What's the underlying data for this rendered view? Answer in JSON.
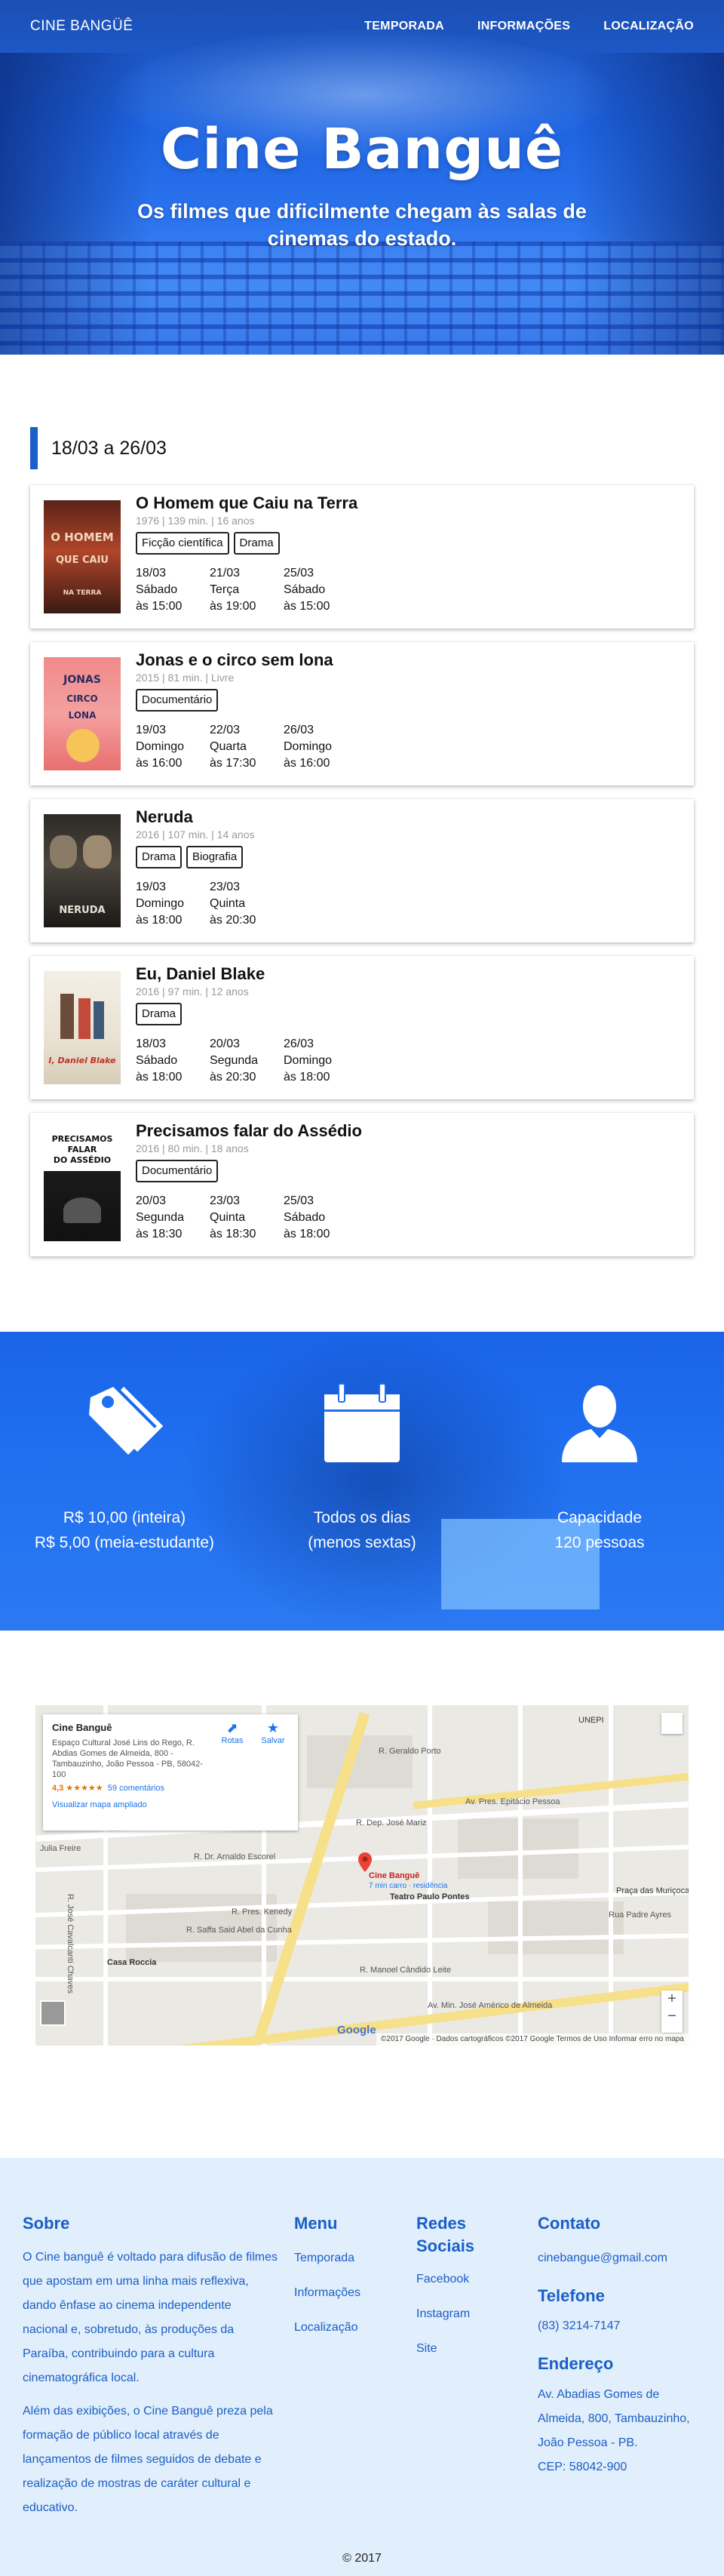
{
  "nav": {
    "brand": "CINE BANGÜÊ",
    "items": [
      "TEMPORADA",
      "INFORMAÇÕES",
      "LOCALIZAÇÃO"
    ]
  },
  "hero": {
    "title": "Cine Banguê",
    "subtitle": "Os filmes que dificilmente chegam às salas de cinemas do estado."
  },
  "schedule": {
    "week": "18/03 a 26/03",
    "movies": [
      {
        "title": "O Homem que Caiu na Terra",
        "meta": "1976 | 139 min. | 16 anos",
        "genres": [
          "Ficção científica",
          "Drama"
        ],
        "poster_text": [
          "O HOMEM",
          "QUE CAIU",
          "NA TERRA"
        ],
        "sessions": [
          {
            "date": "18/03",
            "day": "Sábado",
            "time": "às 15:00"
          },
          {
            "date": "21/03",
            "day": "Terça",
            "time": "às 19:00"
          },
          {
            "date": "25/03",
            "day": "Sábado",
            "time": "às 15:00"
          }
        ]
      },
      {
        "title": "Jonas e o circo sem lona",
        "meta": "2015 | 81 min. | Livre",
        "genres": [
          "Documentário"
        ],
        "poster_text": [
          "JONAS",
          "CIRCO",
          "LONA"
        ],
        "sessions": [
          {
            "date": "19/03",
            "day": "Domingo",
            "time": "às 16:00"
          },
          {
            "date": "22/03",
            "day": "Quarta",
            "time": "às 17:30"
          },
          {
            "date": "26/03",
            "day": "Domingo",
            "time": "às 16:00"
          }
        ]
      },
      {
        "title": "Neruda",
        "meta": "2016 | 107 min. | 14 anos",
        "genres": [
          "Drama",
          "Biografia"
        ],
        "poster_text": [
          "NERUDA"
        ],
        "sessions": [
          {
            "date": "19/03",
            "day": "Domingo",
            "time": "às 18:00"
          },
          {
            "date": "23/03",
            "day": "Quinta",
            "time": "às 20:30"
          }
        ]
      },
      {
        "title": "Eu, Daniel Blake",
        "meta": "2016 | 97 min. | 12 anos",
        "genres": [
          "Drama"
        ],
        "poster_text": [
          "I, Daniel Blake"
        ],
        "sessions": [
          {
            "date": "18/03",
            "day": "Sábado",
            "time": "às 18:00"
          },
          {
            "date": "20/03",
            "day": "Segunda",
            "time": "às 20:30"
          },
          {
            "date": "26/03",
            "day": "Domingo",
            "time": "às 18:00"
          }
        ]
      },
      {
        "title": "Precisamos falar do Assédio",
        "meta": "2016 | 80 min. | 18 anos",
        "genres": [
          "Documentário"
        ],
        "poster_text": [
          "PRECISAMOS",
          "FALAR",
          "DO ASSÉDIO"
        ],
        "sessions": [
          {
            "date": "20/03",
            "day": "Segunda",
            "time": "às 18:30"
          },
          {
            "date": "23/03",
            "day": "Quinta",
            "time": "às 18:30"
          },
          {
            "date": "25/03",
            "day": "Sábado",
            "time": "às 18:00"
          }
        ]
      }
    ]
  },
  "info": {
    "price": {
      "icon": "price-tag-icon",
      "lines": [
        "R$ 10,00 (inteira)",
        "R$ 5,00 (meia-estudante)"
      ]
    },
    "days": {
      "icon": "calendar-icon",
      "lines": [
        "Todos os dias",
        "(menos sextas)"
      ]
    },
    "capacity": {
      "icon": "person-icon",
      "lines": [
        "Capacidade",
        "120 pessoas"
      ]
    }
  },
  "map": {
    "place_name": "Cine Banguê",
    "address": "Espaço Cultural José Lins do Rego, R. Abdias Gomes de Almeida, 800 - Tambauzinho, João Pessoa - PB, 58042-100",
    "rating": "4,3 ★★★★★",
    "reviews": "59 comentários",
    "larger_map": "Visualizar mapa ampliado",
    "directions": "Rotas",
    "save": "Salvar",
    "pin_label": "Cine Banguê",
    "pin_sub": "7 min carro · residência",
    "labels": [
      "Teatro Paulo Pontes",
      "Casa Roccia",
      "Praça das Muriçocas",
      "UNEPI",
      "R. Dep. José Mariz",
      "R. Dr. Arnaldo Escorel",
      "R. Pres. Kenedy",
      "R. Saffa Said Abel da Cunha",
      "R. Manoel Cândido Leite",
      "Av. Min. José Américo de Almeida",
      "Av. Pres. Epitácio Pessoa",
      "R. Geraldo Porto",
      "Rua Padre Ayres",
      "Julia Freire",
      "R. José Cavalcanti Chaves"
    ],
    "attribution": "©2017 Google · Dados cartográficos ©2017 Google    Termos de Uso    Informar erro no mapa",
    "google": "Google"
  },
  "footer": {
    "about_title": "Sobre",
    "about_p1": "O Cine banguê é voltado para difusão de filmes que apostam em uma linha mais reflexiva, dando ênfase ao cinema independente nacional e, sobretudo, às produções da Paraíba, contribuindo para a cultura cinematográfica local.",
    "about_p2": "Além das exibições, o Cine Banguê preza pela formação de público local através de lançamentos de filmes seguidos de debate e realização de mostras de caráter cultural e educativo.",
    "menu_title": "Menu",
    "menu_items": [
      "Temporada",
      "Informações",
      "Localização"
    ],
    "social_title": "Redes Sociais",
    "social_items": [
      "Facebook",
      "Instagram",
      "Site"
    ],
    "contact_title": "Contato",
    "email": "cinebangue@gmail.com",
    "phone_title": "Telefone",
    "phone": "(83) 3214-7147",
    "address_title": "Endereço",
    "address": "Av. Abadias Gomes de Almeida, 800, Tambauzinho, João Pessoa - PB.",
    "cep": "CEP: 58042-900",
    "copyright": "© 2017"
  },
  "colors": {
    "accent": "#1a5fc7",
    "band": "#1f6ff0",
    "footer_bg": "#e1eefb"
  }
}
